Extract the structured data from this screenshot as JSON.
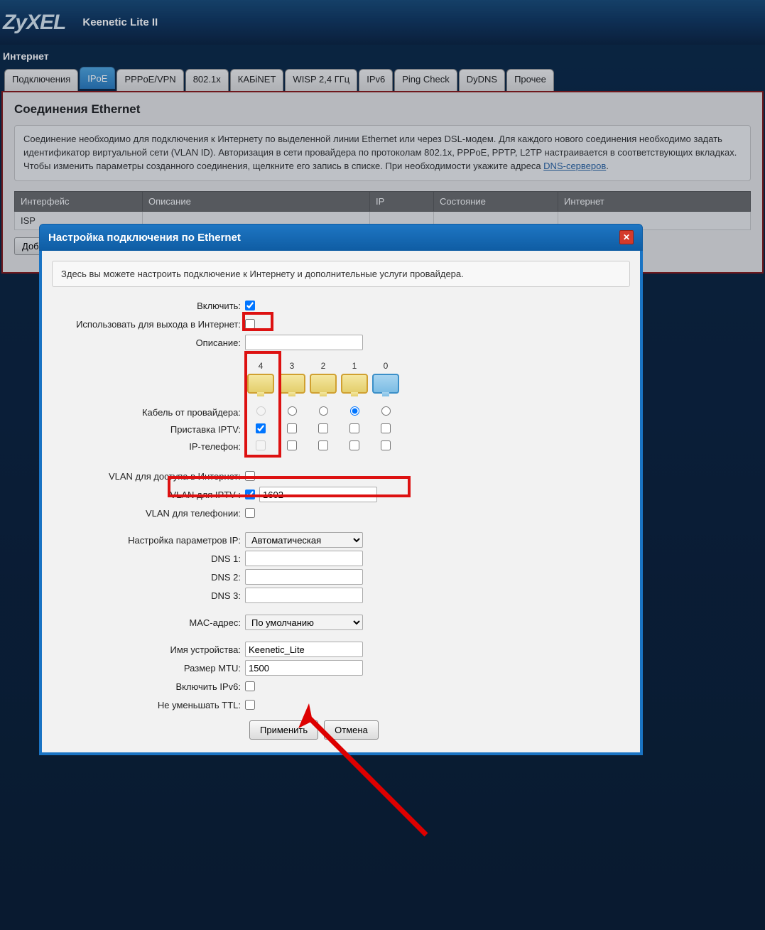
{
  "brand": "ZyXEL",
  "model": "Keenetic Lite II",
  "section": "Интернет",
  "tabs": [
    "Подключения",
    "IPoE",
    "PPPoE/VPN",
    "802.1x",
    "КАБiNET",
    "WISP 2,4 ГГц",
    "IPv6",
    "Ping Check",
    "DyDNS",
    "Прочее"
  ],
  "active_tab_index": 1,
  "panel": {
    "title": "Соединения Ethernet",
    "desc_prefix": "Соединение необходимо для подключения к Интернету по выделенной линии Ethernet или через DSL-модем. Для каждого нового соединения необходимо задать идентификатор виртуальной сети (VLAN ID). Авторизация в сети провайдера по протоколам 802.1x, PPPoE, PPTP, L2TP настраивается в соответствующих вкладках. Чтобы изменить параметры созданного соединения, щелкните его запись в списке. При необходимости укажите адреса ",
    "dns_link": "DNS-серверов",
    "desc_suffix": ".",
    "cols": [
      "Интерфейс",
      "Описание",
      "IP",
      "Состояние",
      "Интернет"
    ],
    "row0_iface": "ISP",
    "add_btn": "Добавить интерфейс"
  },
  "modal": {
    "title": "Настройка подключения по Ethernet",
    "info": "Здесь вы можете настроить подключение к Интернету и дополнительные услуги провайдера.",
    "labels": {
      "enable": "Включить:",
      "use_internet": "Использовать для выхода в Интернет:",
      "description": "Описание:",
      "isp_cable": "Кабель от провайдера:",
      "iptv_box": "Приставка IPTV:",
      "ip_phone": "IP-телефон:",
      "vlan_inet": "VLAN для доступа в Интернет:",
      "vlan_iptv": "VLAN для IPTV :",
      "vlan_tel": "VLAN для телефонии:",
      "ip_params": "Настройка параметров IP:",
      "dns1": "DNS 1:",
      "dns2": "DNS 2:",
      "dns3": "DNS 3:",
      "mac": "MAC-адрес:",
      "devname": "Имя устройства:",
      "mtu": "Размер MTU:",
      "ipv6": "Включить IPv6:",
      "ttl": "Не уменьшать TTL:"
    },
    "ports": [
      "4",
      "3",
      "2",
      "1",
      "0"
    ],
    "values": {
      "enable": true,
      "use_internet": false,
      "description": "",
      "isp_cable_col": 3,
      "iptv_cols": [
        0
      ],
      "vlan_inet_chk": false,
      "vlan_iptv_chk": true,
      "vlan_iptv_val": "1602",
      "vlan_tel_chk": false,
      "ip_params": "Автоматическая",
      "dns1": "",
      "dns2": "",
      "dns3": "",
      "mac": "По умолчанию",
      "devname": "Keenetic_Lite",
      "mtu": "1500",
      "ipv6": false,
      "ttl": false
    },
    "apply": "Применить",
    "cancel": "Отмена"
  }
}
